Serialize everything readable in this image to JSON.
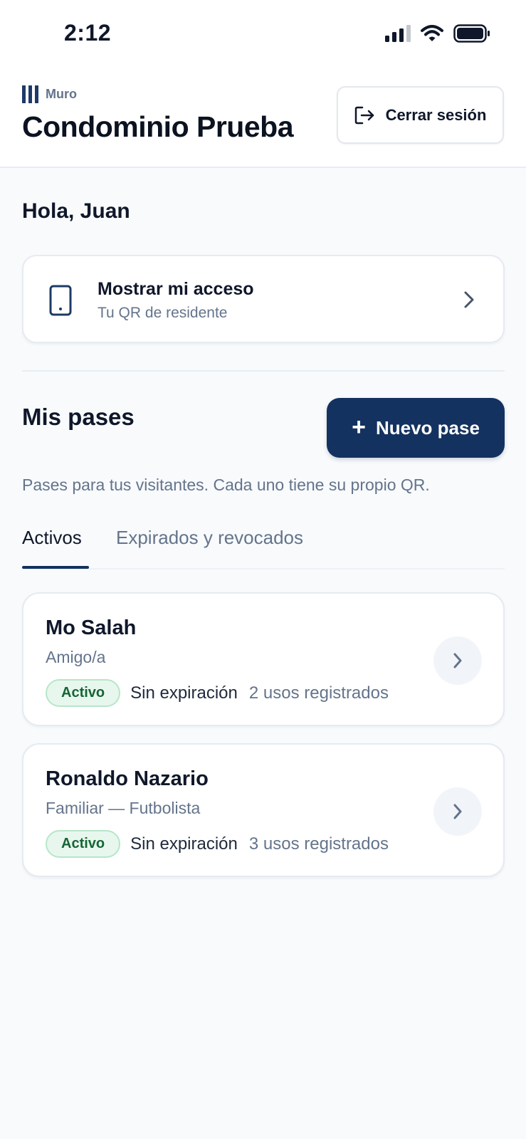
{
  "status_bar": {
    "time": "2:12"
  },
  "header": {
    "brand_name": "Muro",
    "title": "Condominio Prueba",
    "logout_label": "Cerrar sesión"
  },
  "greeting": "Hola, Juan",
  "access_card": {
    "title": "Mostrar mi acceso",
    "subtitle": "Tu QR de residente"
  },
  "passes_section": {
    "title": "Mis pases",
    "new_pass_label": "Nuevo pase",
    "description": "Pases para tus visitantes. Cada uno tiene su propio QR.",
    "tabs": [
      {
        "label": "Activos",
        "active": true
      },
      {
        "label": "Expirados y revocados",
        "active": false
      }
    ],
    "passes": [
      {
        "name": "Mo Salah",
        "relation": "Amigo/a",
        "status": "Activo",
        "expiration": "Sin expiración",
        "uses": "2 usos registrados"
      },
      {
        "name": "Ronaldo Nazario",
        "relation": "Familiar — Futbolista",
        "status": "Activo",
        "expiration": "Sin expiración",
        "uses": "3 usos registrados"
      }
    ]
  },
  "colors": {
    "primary": "#14325f",
    "badge_text": "#166534",
    "badge_bg": "#e7f7ee",
    "muted_text": "#64748b",
    "background": "#f8fafc"
  },
  "icons": [
    "signal-icon",
    "wifi-icon",
    "battery-icon",
    "brand-logo-icon",
    "logout-icon",
    "phone-icon",
    "chevron-right-icon",
    "plus-icon"
  ]
}
